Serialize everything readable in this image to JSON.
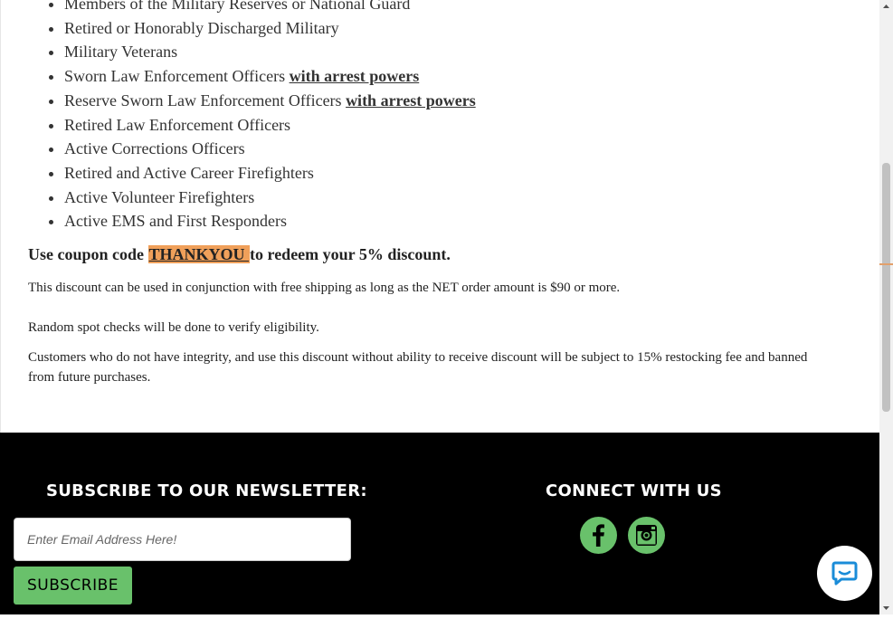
{
  "eligibility_list": [
    {
      "text": "Members of the Military Reserves or National Guard",
      "bold": ""
    },
    {
      "text": "Retired or Honorably Discharged Military",
      "bold": ""
    },
    {
      "text": "Military Veterans",
      "bold": ""
    },
    {
      "text": "Sworn Law Enforcement Officers ",
      "bold": "with arrest powers"
    },
    {
      "text": "Reserve Sworn Law Enforcement Officers ",
      "bold": "with arrest powers"
    },
    {
      "text": "Retired Law Enforcement Officers",
      "bold": ""
    },
    {
      "text": "Active Corrections Officers",
      "bold": ""
    },
    {
      "text": "Retired and Active Career Firefighters",
      "bold": ""
    },
    {
      "text": "Active Volunteer Firefighters",
      "bold": ""
    },
    {
      "text": "Active EMS and First Responders",
      "bold": ""
    }
  ],
  "coupon": {
    "prefix": "Use coupon code ",
    "code": "THANKYOU ",
    "suffix": "to redeem your 5% discount."
  },
  "paragraphs": {
    "p1": "This discount can be used in conjunction with free shipping as long as the NET order amount is $90 or more.",
    "p2": "Random spot checks will be done to verify eligibility.",
    "p3": "Customers who do not have integrity, and use this discount without ability to receive discount will be subject to 15% restocking fee and banned from future purchases."
  },
  "footer": {
    "newsletter_title": "SUBSCRIBE TO OUR NEWSLETTER:",
    "email_placeholder": "Enter Email Address Here!",
    "subscribe_label": "SUBSCRIBE",
    "connect_title": "CONNECT WITH US",
    "social_icons": [
      "facebook-icon",
      "instagram-icon"
    ]
  },
  "colors": {
    "accent_green": "#69c16b",
    "coupon_highlight": "#f0a05a",
    "footer_bg": "#000000",
    "chat_icon": "#1a8cd8"
  },
  "icons": {
    "chat": "chat-bubble-icon"
  }
}
